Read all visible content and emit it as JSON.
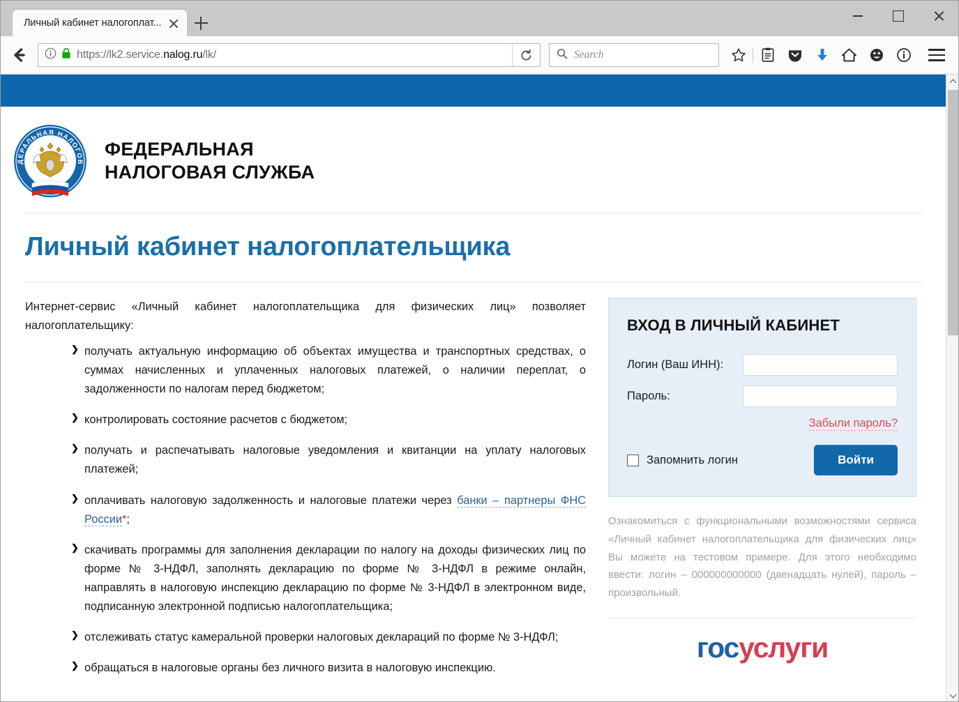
{
  "browser": {
    "tab": {
      "title": "Личный кабинет налогоплат...",
      "close_label": "✕"
    },
    "new_tab_label": "+",
    "window_controls": {
      "minimize": "—",
      "maximize": "□",
      "close": "✕"
    },
    "url": {
      "scheme": "https://",
      "host_pre": "lk2.service.",
      "host_bold": "nalog.ru",
      "path": "/lk/",
      "full": "https://lk2.service.nalog.ru/lk/"
    },
    "search": {
      "placeholder": "Search"
    },
    "icons": {
      "back": "back-arrow-icon",
      "info": "page-info-icon",
      "lock": "lock-icon",
      "reload": "reload-icon",
      "search": "search-icon",
      "bookmark": "star-icon",
      "library": "library-icon",
      "pocket": "pocket-icon",
      "downloads": "download-arrow-icon",
      "home": "home-icon",
      "account": "smiley-face-icon",
      "identity": "info-circle-icon",
      "menu": "hamburger-menu-icon"
    }
  },
  "site": {
    "brand": {
      "line1": "ФЕДЕРАЛЬНАЯ",
      "line2": "НАЛОГОВАЯ СЛУЖБА",
      "logo_name": "fns-emblem"
    },
    "page_title": "Личный кабинет налогоплательщика",
    "intro": "Интернет-сервис «Личный кабинет налогоплательщика для физических лиц» позволяет налогоплательщику:",
    "features": [
      {
        "text": "получать актуальную информацию об объектах имущества и транспортных средствах, о суммах начисленных и уплаченных налоговых платежей, о наличии переплат, о задолженности по налогам перед бюджетом;"
      },
      {
        "text": "контролировать состояние расчетов с бюджетом;"
      },
      {
        "text": "получать и распечатывать налоговые уведомления и квитанции на уплату налоговых платежей;"
      },
      {
        "text_before": "оплачивать налоговую задолженность и налоговые платежи через ",
        "link": "банки – партнеры ФНС России",
        "asterisk": "*",
        "text_after": ";"
      },
      {
        "text": "скачивать программы для заполнения декларации по налогу на доходы физических лиц по форме № 3-НДФЛ, заполнять декларацию по форме № 3-НДФЛ в режиме онлайн, направлять в налоговую инспекцию декларацию по форме № 3-НДФЛ в электронном виде, подписанную электронной подписью налогоплательщика;"
      },
      {
        "text": "отслеживать статус камеральной проверки налоговых деклараций по форме № 3-НДФЛ;"
      },
      {
        "text": "обращаться в налоговые органы без личного визита в налоговую инспекцию."
      }
    ],
    "login": {
      "heading": "ВХОД В ЛИЧНЫЙ КАБИНЕТ",
      "login_label": "Логин (Ваш ИНН):",
      "login_value": "",
      "login_placeholder": "",
      "password_label": "Пароль:",
      "password_value": "",
      "password_placeholder": "",
      "forgot_link": "Забыли пароль?",
      "remember_label": "Запомнить логин",
      "remember_checked": false,
      "submit_label": "Войти"
    },
    "help_text": "Ознакомиться с функциональными возможностями сервиса «Личный кабинет налогоплательщика для физических лиц» Вы можете на тестовом примере. Для этого необходимо ввести: логин – 000000000000 (двенадцать нулей), пароль – произвольный.",
    "gosuslugi": {
      "part_blue": "гос",
      "part_red": "услуги"
    }
  },
  "colors": {
    "header_blue": "#0b66ae",
    "title_blue": "#1b6fa8",
    "button_blue": "#1268a8",
    "link_red": "#e24a4a",
    "panel_bg": "#e6eff8",
    "gos_blue": "#1f5fa8",
    "gos_red": "#d44050"
  }
}
